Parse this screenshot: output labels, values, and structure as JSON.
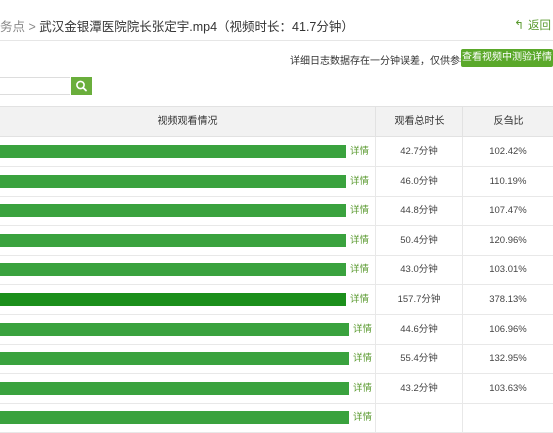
{
  "header": {
    "breadcrumb_prefix": "务点 >",
    "title": "武汉金银潭医院院长张定宇.mp4（视频时长：41.7分钟）",
    "back_label": "返回"
  },
  "info_note": "详细日志数据存在一分钟误差，仅供参考",
  "detail_button_label": "查看视频中测验详情",
  "search": {
    "value": "",
    "placeholder": ""
  },
  "table": {
    "columns": [
      "视频观看情况",
      "观看总时长",
      "反刍比"
    ],
    "rows": [
      {
        "bar_fraction": 0.625,
        "detail": "详情",
        "duration": "42.7分钟",
        "ratio": "102.42%"
      },
      {
        "bar_fraction": 0.625,
        "detail": "详情",
        "duration": "46.0分钟",
        "ratio": "110.19%"
      },
      {
        "bar_fraction": 0.625,
        "detail": "详情",
        "duration": "44.8分钟",
        "ratio": "107.47%"
      },
      {
        "bar_fraction": 0.625,
        "detail": "详情",
        "duration": "50.4分钟",
        "ratio": "120.96%"
      },
      {
        "bar_fraction": 0.625,
        "detail": "详情",
        "duration": "43.0分钟",
        "ratio": "103.01%"
      },
      {
        "bar_fraction": 0.625,
        "detail": "详情",
        "duration": "157.7分钟",
        "ratio": "378.13%",
        "dark": true
      },
      {
        "bar_fraction": 0.631,
        "detail": "详情",
        "duration": "44.6分钟",
        "ratio": "106.96%"
      },
      {
        "bar_fraction": 0.631,
        "detail": "详情",
        "duration": "55.4分钟",
        "ratio": "132.95%"
      },
      {
        "bar_fraction": 0.631,
        "detail": "详情",
        "duration": "43.2分钟",
        "ratio": "103.63%"
      },
      {
        "bar_fraction": 0.631,
        "detail": "详情",
        "duration": "",
        "ratio": ""
      }
    ]
  },
  "colors": {
    "accent": "#5aa82a",
    "bar": "#3aa23e",
    "bar_dark": "#1b8f1b"
  }
}
